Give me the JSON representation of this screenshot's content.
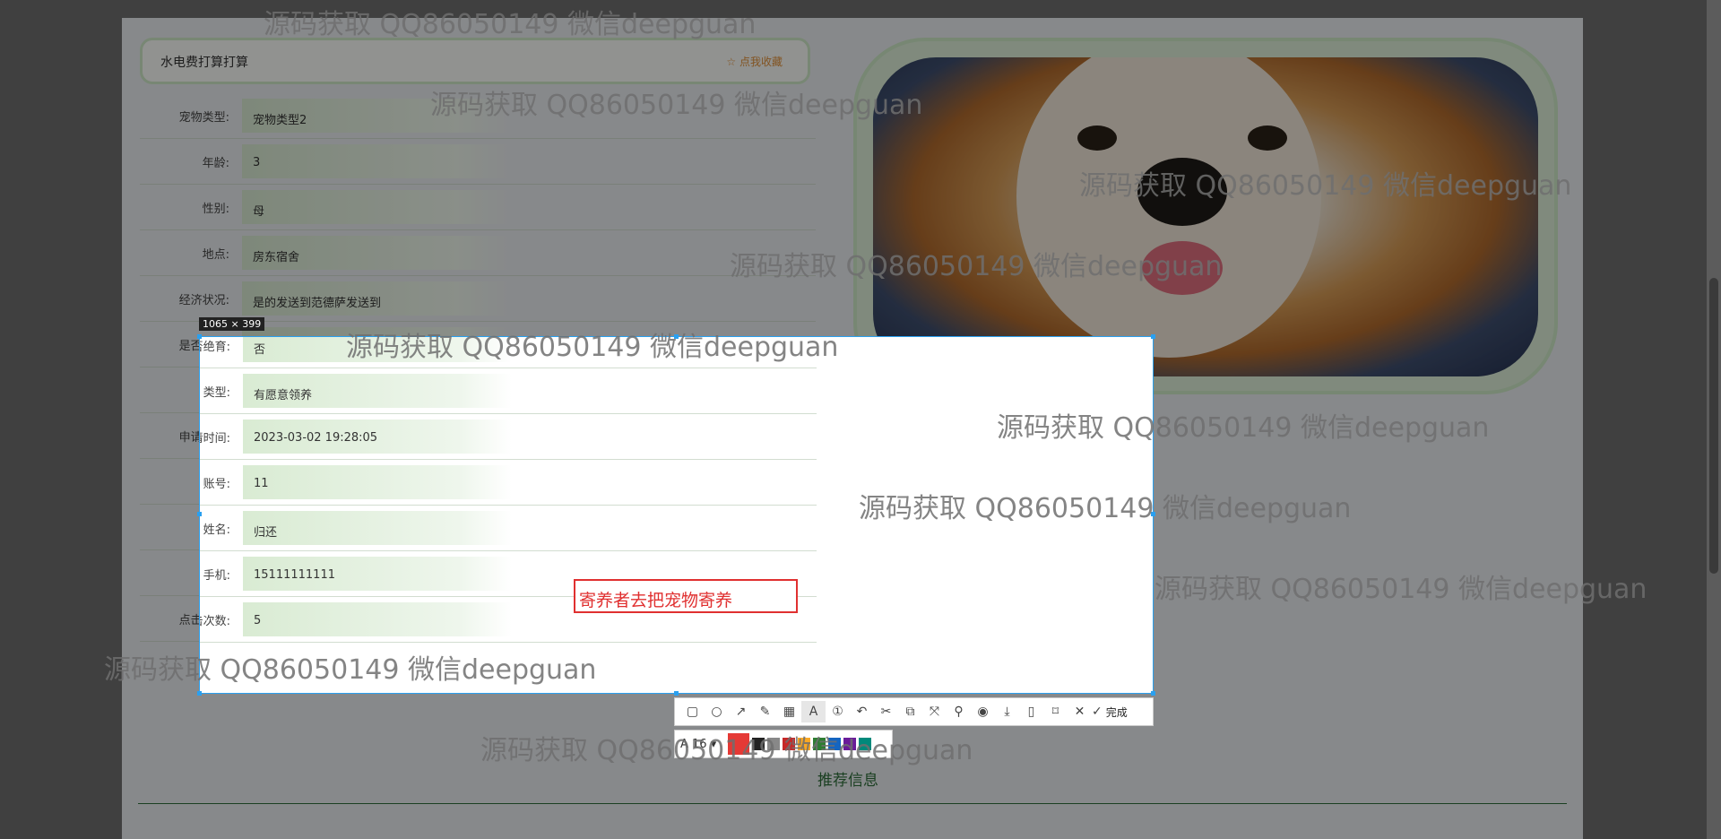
{
  "header": {
    "title": "水电费打算打算",
    "favorite": "☆ 点我收藏"
  },
  "fields": [
    {
      "label": "宠物类型:",
      "value": "宠物类型2"
    },
    {
      "label": "年龄:",
      "value": "3"
    },
    {
      "label": "性别:",
      "value": "母"
    },
    {
      "label": "地点:",
      "value": "房东宿舍"
    },
    {
      "label": "经济状况:",
      "value": "是的发送到范德萨发送到"
    },
    {
      "label": "是否绝育:",
      "value": "否"
    },
    {
      "label": "类型:",
      "value": "有愿意领养"
    },
    {
      "label": "申请时间:",
      "value": "2023-03-02 19:28:05"
    },
    {
      "label": "账号:",
      "value": "11"
    },
    {
      "label": "姓名:",
      "value": "归还"
    },
    {
      "label": "手机:",
      "value": "15111111111"
    },
    {
      "label": "点击次数:",
      "value": "5"
    }
  ],
  "capture": {
    "size_label": "1065 × 399",
    "text_annotation": "寄养者去把宠物寄养",
    "toolbar_done": "完成",
    "font_size": "16",
    "selected_color": "#e53935",
    "palette": [
      "#222222",
      "#888888",
      "#c62828",
      "#f9a825",
      "#2e7d32",
      "#1565c0",
      "#6a1b9a",
      "#00897b"
    ]
  },
  "recommend": {
    "title": "推荐信息"
  },
  "watermark": "源码获取 QQ86050149 微信deepguan"
}
